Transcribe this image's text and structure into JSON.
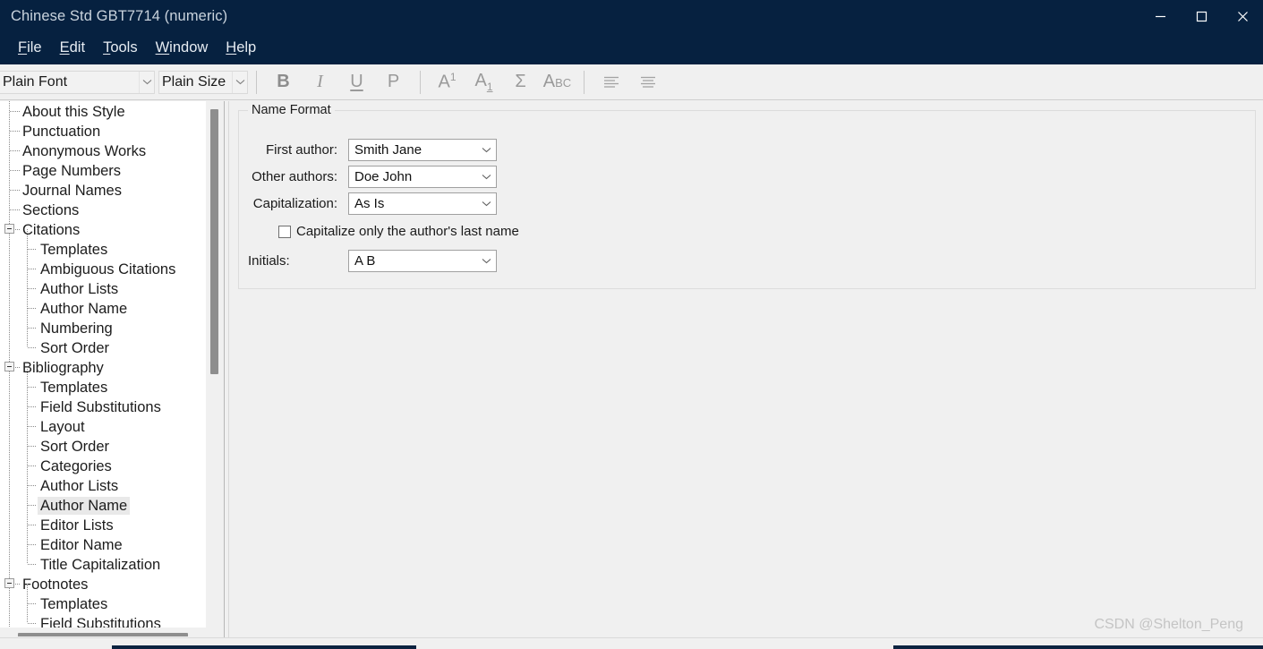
{
  "window": {
    "title": "Chinese Std GBT7714 (numeric)",
    "controls": [
      {
        "name": "minimize",
        "glyph": "minimize-icon"
      },
      {
        "name": "maximize",
        "glyph": "maximize-icon"
      },
      {
        "name": "close",
        "glyph": "close-icon"
      }
    ]
  },
  "menubar": {
    "items": [
      {
        "accel": "F",
        "rest": "ile"
      },
      {
        "accel": "E",
        "rest": "dit"
      },
      {
        "accel": "T",
        "rest": "ools"
      },
      {
        "accel": "W",
        "rest": "indow"
      },
      {
        "accel": "H",
        "rest": "elp"
      }
    ]
  },
  "toolbar": {
    "font_combo": "Plain Font",
    "size_combo": "Plain Size",
    "buttons": [
      {
        "id": "bold",
        "label": "B"
      },
      {
        "id": "italic",
        "label": "I"
      },
      {
        "id": "underline",
        "label": "U"
      },
      {
        "id": "plain",
        "label": "P"
      },
      {
        "id": "superscript",
        "label": "A"
      },
      {
        "id": "subscript",
        "label": "A"
      },
      {
        "id": "symbol",
        "label": "Σ"
      },
      {
        "id": "small-caps",
        "label": "A"
      },
      {
        "id": "align-left",
        "label": ""
      },
      {
        "id": "align-center",
        "label": ""
      }
    ]
  },
  "tree": {
    "selected": "Author Name",
    "nodes": [
      {
        "label": "About this Style",
        "depth": 0,
        "type": "leaf"
      },
      {
        "label": "Punctuation",
        "depth": 0,
        "type": "leaf"
      },
      {
        "label": "Anonymous Works",
        "depth": 0,
        "type": "leaf"
      },
      {
        "label": "Page Numbers",
        "depth": 0,
        "type": "leaf"
      },
      {
        "label": "Journal Names",
        "depth": 0,
        "type": "leaf"
      },
      {
        "label": "Sections",
        "depth": 0,
        "type": "leaf"
      },
      {
        "label": "Citations",
        "depth": 0,
        "type": "expanded"
      },
      {
        "label": "Templates",
        "depth": 1,
        "type": "leaf"
      },
      {
        "label": "Ambiguous Citations",
        "depth": 1,
        "type": "leaf"
      },
      {
        "label": "Author Lists",
        "depth": 1,
        "type": "leaf"
      },
      {
        "label": "Author Name",
        "depth": 1,
        "type": "leaf"
      },
      {
        "label": "Numbering",
        "depth": 1,
        "type": "leaf"
      },
      {
        "label": "Sort Order",
        "depth": 1,
        "type": "leaf-last"
      },
      {
        "label": "Bibliography",
        "depth": 0,
        "type": "expanded"
      },
      {
        "label": "Templates",
        "depth": 1,
        "type": "leaf"
      },
      {
        "label": "Field Substitutions",
        "depth": 1,
        "type": "leaf"
      },
      {
        "label": "Layout",
        "depth": 1,
        "type": "leaf"
      },
      {
        "label": "Sort Order",
        "depth": 1,
        "type": "leaf"
      },
      {
        "label": "Categories",
        "depth": 1,
        "type": "leaf"
      },
      {
        "label": "Author Lists",
        "depth": 1,
        "type": "leaf"
      },
      {
        "label": "Author Name",
        "depth": 1,
        "type": "leaf",
        "selected": true
      },
      {
        "label": "Editor Lists",
        "depth": 1,
        "type": "leaf"
      },
      {
        "label": "Editor Name",
        "depth": 1,
        "type": "leaf"
      },
      {
        "label": "Title Capitalization",
        "depth": 1,
        "type": "leaf-last"
      },
      {
        "label": "Footnotes",
        "depth": 0,
        "type": "expanded"
      },
      {
        "label": "Templates",
        "depth": 1,
        "type": "leaf"
      },
      {
        "label": "Field Substitutions",
        "depth": 1,
        "type": "leaf"
      }
    ]
  },
  "form": {
    "group_title": "Name Format",
    "rows": [
      {
        "label": "First author:",
        "value": "Smith Jane",
        "name": "first-author"
      },
      {
        "label": "Other authors:",
        "value": "Doe John",
        "name": "other-authors"
      },
      {
        "label": "Capitalization:",
        "value": "As Is",
        "name": "capitalization"
      }
    ],
    "checkbox": {
      "label": "Capitalize only the author's last name",
      "checked": false
    },
    "initials": {
      "label": "Initials:",
      "value": "A B"
    }
  },
  "watermark": "CSDN @Shelton_Peng",
  "colors": {
    "titlebar": "#062140",
    "panel": "#f0f0f0",
    "selection": "#e9e9e9",
    "scroll_thumb": "#8e8e8e"
  }
}
